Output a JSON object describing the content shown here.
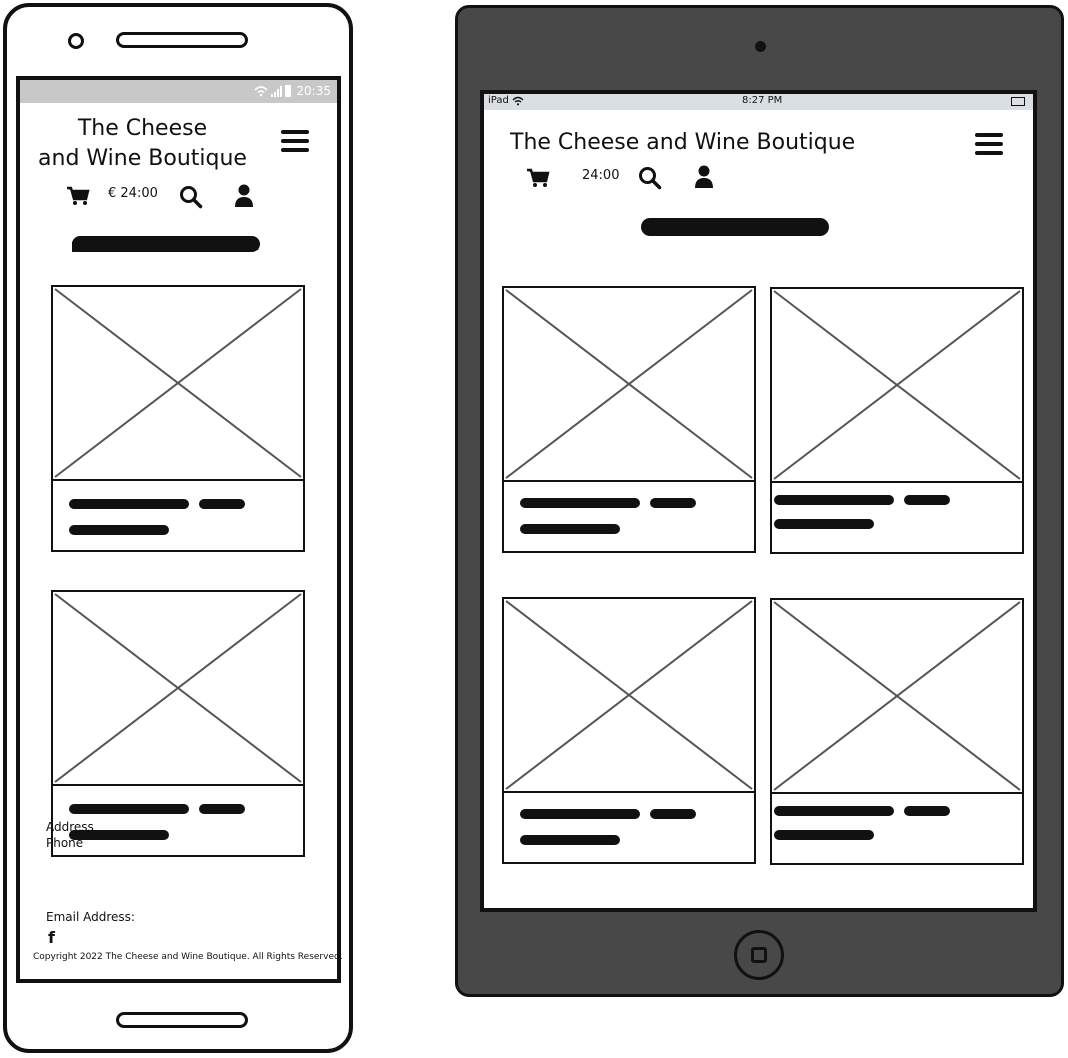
{
  "shop": {
    "name_line1": "The Cheese",
    "name_line2": "and Wine Boutique",
    "name_full": "The Cheese  and Wine Boutique"
  },
  "phone": {
    "status_time": "20:35",
    "basket_total": "€ 24:00",
    "footer": {
      "address_label": "Address",
      "phone_label": "Phone",
      "email_label": "Email Address:",
      "facebook_glyph": "f",
      "copyright": "Copyright 2022 The Cheese and Wine Boutique. All Rights Reserved."
    }
  },
  "tablet": {
    "status_device": "iPad",
    "status_time": "8:27 PM",
    "basket_total": "24:00"
  },
  "icons": {
    "cart": "cart-icon",
    "search": "search-icon",
    "user": "user-icon",
    "menu": "hamburger-menu-icon",
    "facebook": "facebook-icon"
  }
}
